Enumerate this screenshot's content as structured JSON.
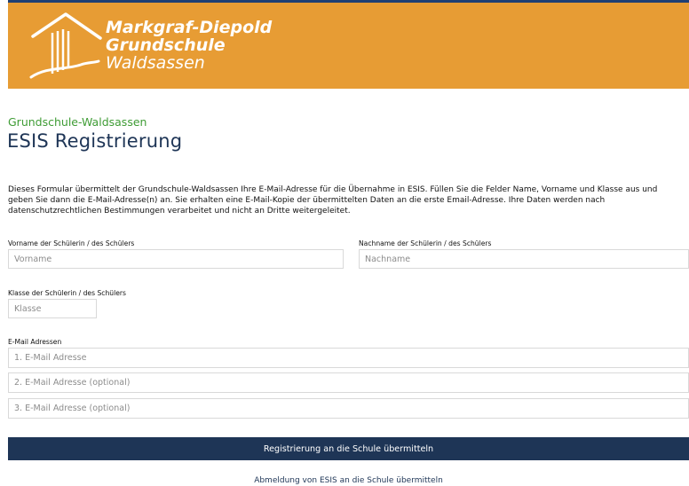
{
  "header": {
    "logo_line1": "Markgraf-Diepold",
    "logo_line2": "Grundschule",
    "logo_line3": "Waldsassen",
    "banner_color": "#e79c34",
    "topline_color": "#1f3f73"
  },
  "school_name": "Grundschule-Waldsassen",
  "page_title": "ESIS Registrierung",
  "intro_text": "Dieses Formular übermittelt der Grundschule-Waldsassen Ihre E-Mail-Adresse für die Übernahme in ESIS. Füllen Sie die Felder Name, Vorname und Klasse aus und geben Sie dann die E-Mail-Adresse(n) an. Sie erhalten eine E-Mail-Kopie der übermittelten Daten an die erste Email-Adresse. Ihre Daten werden nach datenschutzrechtlichen Bestimmungen verarbeitet und nicht an Dritte weitergeleitet.",
  "form": {
    "vorname_label": "Vorname der Schülerin / des Schülers",
    "vorname_placeholder": "Vorname",
    "nachname_label": "Nachname der Schülerin / des Schülers",
    "nachname_placeholder": "Nachname",
    "klasse_label": "Klasse der Schülerin / des Schülers",
    "klasse_placeholder": "Klasse",
    "email_label": "E-Mail Adressen",
    "email1_placeholder": "1. E-Mail Adresse",
    "email2_placeholder": "2. E-Mail Adresse (optional)",
    "email3_placeholder": "3. E-Mail Adresse (optional)",
    "submit_label": "Registrierung an die Schule übermitteln",
    "unsubscribe_label": "Abmeldung von ESIS an die Schule übermitteln"
  },
  "colors": {
    "accent_green": "#3f9c35",
    "navy": "#1e3556"
  }
}
